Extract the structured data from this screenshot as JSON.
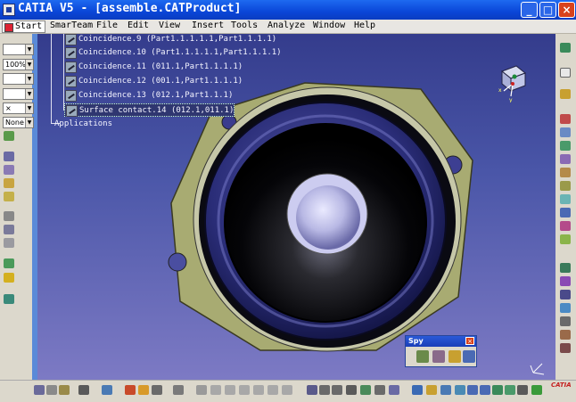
{
  "window": {
    "title": "CATIA V5 - [assemble.CATProduct]",
    "minimize_label": "_",
    "maximize_label": "□",
    "close_label": "×"
  },
  "menubar": {
    "items": [
      "Start",
      "SmarTeam",
      "File",
      "Edit",
      "View",
      "Insert",
      "Tools",
      "Analyze",
      "Window",
      "Help"
    ]
  },
  "left_toolbar": {
    "combos": [
      "",
      "100%",
      "",
      "",
      "×",
      "None"
    ]
  },
  "tree": {
    "rows": [
      "Coincidence.9 (Part1.1.1.1.1,Part1.1.1.1)",
      "Coincidence.10 (Part1.1.1.1.1,Part1.1.1.1)",
      "Coincidence.11 (011.1,Part1.1.1.1)",
      "Coincidence.12 (001.1,Part1.1.1.1)",
      "Coincidence.13 (012.1,Part1.1.1)",
      "Surface contact.14 (012.1,011.1)"
    ],
    "selected_index": 5,
    "applications_label": "Applications"
  },
  "compass": {
    "labels": [
      "x",
      "y"
    ]
  },
  "spy_panel": {
    "title": "Spy",
    "close_label": "×"
  },
  "colors": {
    "titlebar": "#0a46d8",
    "viewport_top": "#343c8c",
    "viewport_bottom": "#7d7ac4",
    "speaker_frame": "#a8ab72",
    "speaker_surround": "#232666"
  },
  "brand": {
    "logo_text": "CATIA"
  }
}
